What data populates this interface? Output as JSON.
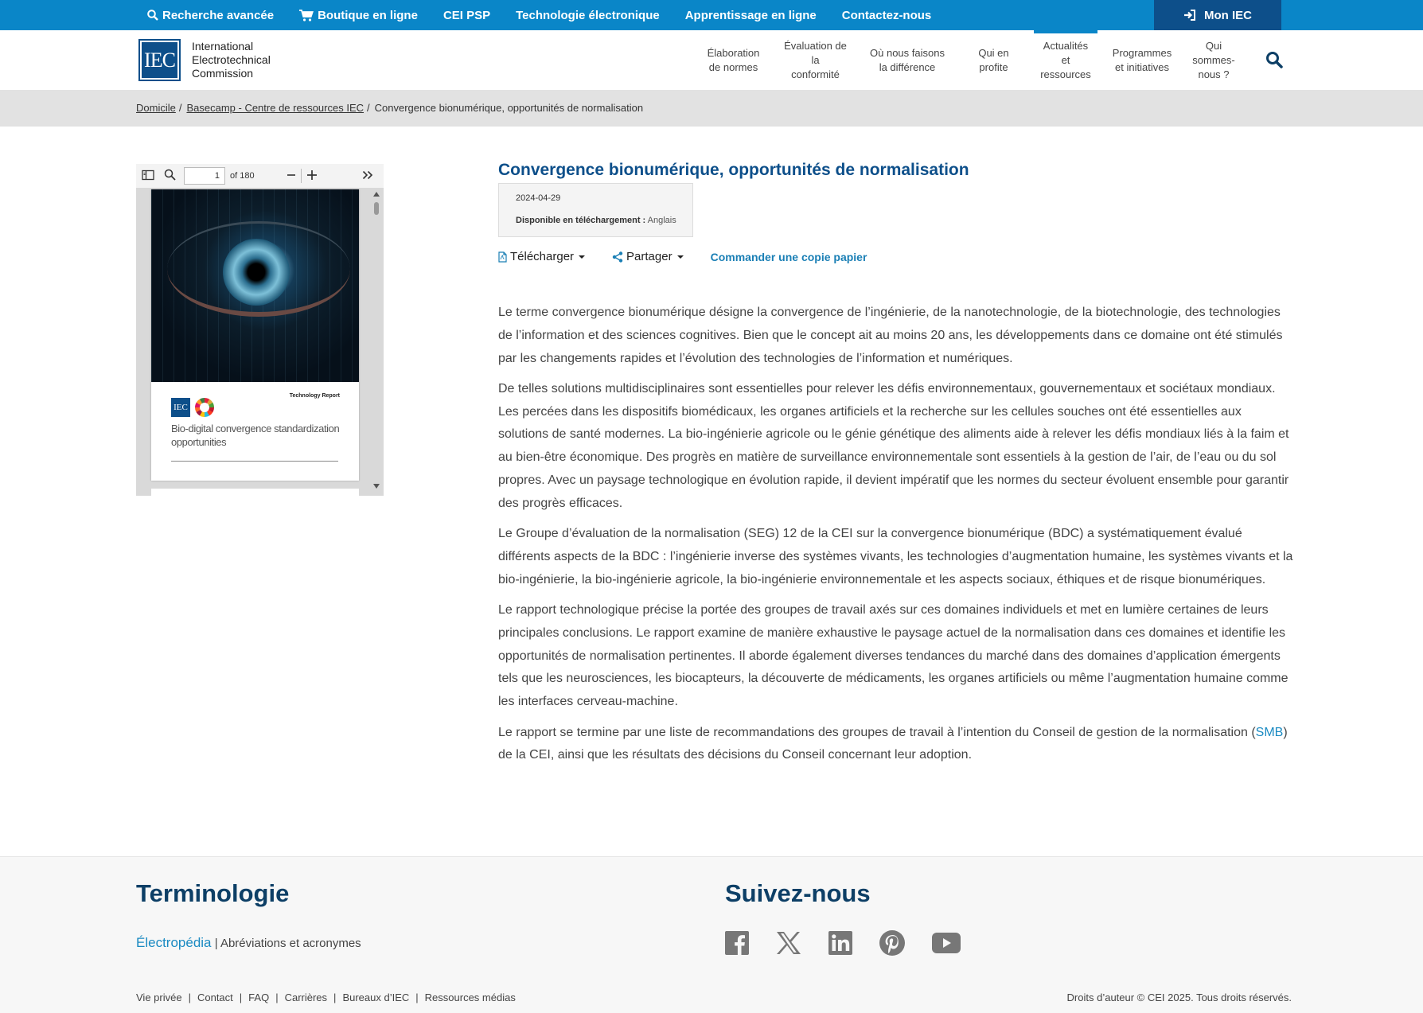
{
  "topbar": {
    "links": [
      {
        "label": "Recherche avancée",
        "icon": "search-icon"
      },
      {
        "label": "Boutique en ligne",
        "icon": "cart-icon"
      },
      {
        "label": "CEI PSP"
      },
      {
        "label": "Technologie électronique"
      },
      {
        "label": "Apprentissage en ligne"
      },
      {
        "label": "Contactez-nous"
      }
    ],
    "my_iec": "Mon IEC",
    "color": "#0a86c8",
    "my_iec_color": "#0d4f8a"
  },
  "header": {
    "logo_mark": "IEC",
    "logo_lines": [
      "International",
      "Electrotechnical",
      "Commission"
    ],
    "nav": [
      {
        "label": "Élaboration\nde normes"
      },
      {
        "label": "Évaluation de la\nconformité"
      },
      {
        "label": "Où nous faisons\nla différence"
      },
      {
        "label": "Qui en\nprofite"
      },
      {
        "label": "Actualités\net\nressources",
        "active": true
      },
      {
        "label": "Programmes\net initiatives"
      },
      {
        "label": "Qui\nsommes-\nnous ?"
      }
    ]
  },
  "breadcrumb": {
    "items": [
      "Domicile",
      "Basecamp - Centre de ressources IEC"
    ],
    "current": "Convergence bionumérique, opportunités de normalisation"
  },
  "viewer": {
    "page": "1",
    "of": "of 180",
    "cover": {
      "tag": "Technology Report",
      "logo_mark": "IEC",
      "title": "Bio-digital convergence standardization opportunities"
    }
  },
  "document": {
    "title": "Convergence bionumérique, opportunités de normalisation",
    "date": "2024-04-29",
    "available_label": "Disponible en téléchargement :",
    "available_lang": "Anglais",
    "download": "Télécharger",
    "share": "Partager",
    "order": "Commander une copie papier",
    "paragraphs": [
      "Le terme convergence bionumérique désigne la convergence de l’ingénierie, de la nanotechnologie, de la biotechnologie, des technologies de l’information et des sciences cognitives. Bien que le concept ait au moins 20 ans, les développements dans ce domaine ont été stimulés par les changements rapides et l’évolution des technologies de l’information et numériques.",
      "De telles solutions multidisciplinaires sont essentielles pour relever les défis environnementaux, gouvernementaux et sociétaux mondiaux. Les percées dans les dispositifs biomédicaux, les organes artificiels et la recherche sur les cellules souches ont été essentielles aux solutions de santé modernes. La bio-ingénierie agricole ou le génie génétique des aliments aide à relever les défis mondiaux liés à la faim et au bien-être économique. Des progrès en matière de surveillance environnementale sont essentiels à la gestion de l’air, de l’eau ou du sol propres. Avec un paysage technologique en évolution rapide, il devient impératif que les normes du secteur évoluent ensemble pour garantir des progrès efficaces.",
      "Le Groupe d’évaluation de la normalisation (SEG) 12 de la CEI sur la convergence bionumérique (BDC) a systématiquement évalué différents aspects de la BDC : l’ingénierie inverse des systèmes vivants, les technologies d’augmentation humaine, les systèmes vivants et la bio-ingénierie, la bio-ingénierie agricole, la bio-ingénierie environnementale et les aspects sociaux, éthiques et de risque bionumériques.",
      "Le rapport technologique précise la portée des groupes de travail axés sur ces domaines individuels et met en lumière certaines de leurs principales conclusions. Le rapport examine de manière exhaustive le paysage actuel de la normalisation dans ces domaines et identifie les opportunités de normalisation pertinentes. Il aborde également diverses tendances du marché dans des domaines d’application émergents tels que les neurosciences, les biocapteurs, la découverte de médicaments, les organes artificiels ou même l’augmentation humaine comme les interfaces cerveau-machine."
    ],
    "last_paragraph": {
      "before": "Le rapport se termine par une liste de recommandations des groupes de travail à l’intention du Conseil de gestion de la normalisation (",
      "link": "SMB",
      "after": ") de la CEI, ainsi que les résultats des décisions du Conseil concernant leur adoption."
    }
  },
  "footer": {
    "terminology_title": "Terminologie",
    "electropedia": "Électropédia",
    "separator": "|",
    "abbreviations": "Abréviations et acronymes",
    "follow_title": "Suivez-nous",
    "social": [
      "facebook-icon",
      "x-icon",
      "linkedin-icon",
      "pinterest-icon",
      "youtube-icon"
    ],
    "links": [
      "Vie privée",
      "Contact",
      "FAQ",
      "Carrières",
      "Bureaux d’IEC",
      "Ressources médias"
    ],
    "copyright": "Droits d’auteur © CEI 2025. Tous droits réservés."
  }
}
